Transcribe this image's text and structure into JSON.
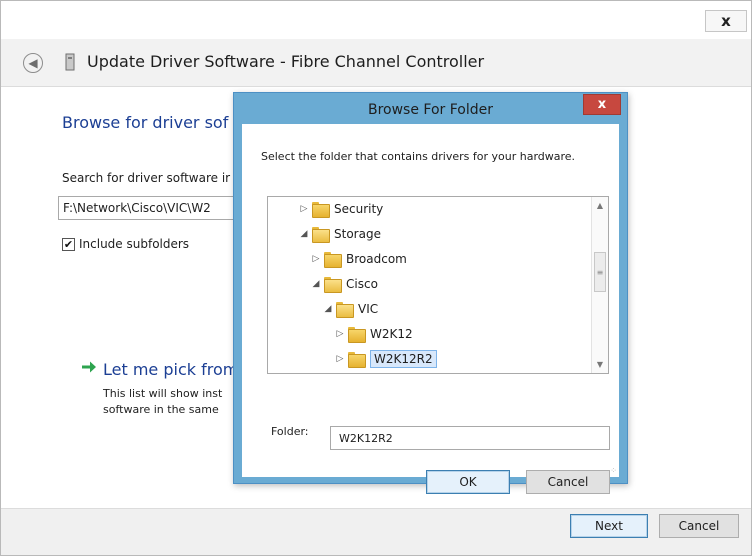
{
  "wizard": {
    "close_glyph": "x",
    "title": "Update Driver Software - Fibre Channel Controller",
    "heading": "Browse for driver sof",
    "search_label": "Search for driver software ir",
    "path_value": "F:\\Network\\Cisco\\VIC\\W2",
    "include_subfolders_label": "Include subfolders",
    "include_subfolders_checked": true,
    "pick_title": "Let me pick from",
    "pick_desc_line1": "This list will show inst",
    "pick_desc_line2": "software in the same",
    "next_label": "Next",
    "cancel_label": "Cancel"
  },
  "dialog": {
    "title": "Browse For Folder",
    "close_glyph": "x",
    "instruction": "Select the folder that contains drivers for your hardware.",
    "tree": [
      {
        "label": "Security",
        "expander": "▷",
        "expanded": false
      },
      {
        "label": "Storage",
        "expander": "◢",
        "expanded": true
      },
      {
        "label": "Broadcom",
        "expander": "▷",
        "expanded": false
      },
      {
        "label": "Cisco",
        "expander": "◢",
        "expanded": true
      },
      {
        "label": "VIC",
        "expander": "◢",
        "expanded": true
      },
      {
        "label": "W2K12",
        "expander": "▷",
        "expanded": false
      },
      {
        "label": "W2K12R2",
        "expander": "▷",
        "expanded": false,
        "selected": true
      }
    ],
    "folder_label": "Folder:",
    "folder_value": "W2K12R2",
    "ok_label": "OK",
    "cancel_label": "Cancel"
  },
  "colors": {
    "link_blue": "#1c3f94",
    "dialog_frame": "#6aabd3",
    "close_red": "#c7483f",
    "arrow_green": "#2ea44f"
  }
}
